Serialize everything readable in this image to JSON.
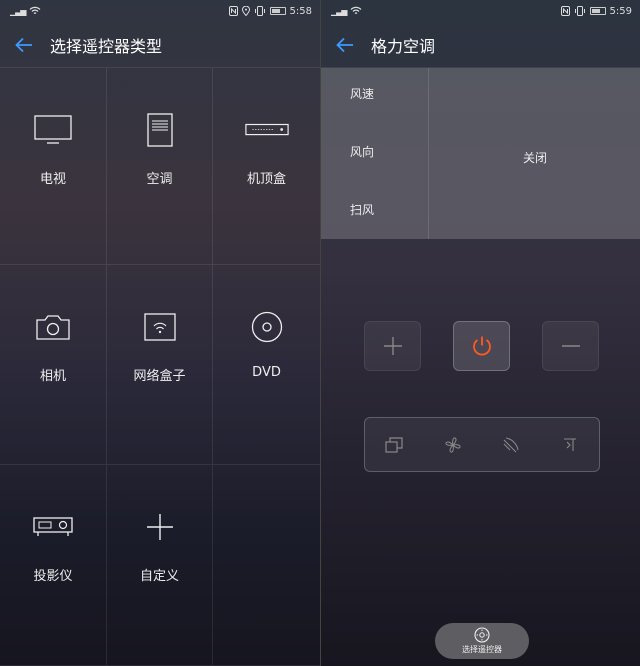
{
  "left": {
    "status": {
      "time": "5:58"
    },
    "title": "选择遥控器类型",
    "devices": [
      {
        "label": "电视",
        "icon": "tv-icon"
      },
      {
        "label": "空调",
        "icon": "air-conditioner-icon"
      },
      {
        "label": "机顶盒",
        "icon": "set-top-box-icon"
      },
      {
        "label": "相机",
        "icon": "camera-icon"
      },
      {
        "label": "网络盒子",
        "icon": "network-box-icon"
      },
      {
        "label": "DVD",
        "icon": "dvd-icon"
      },
      {
        "label": "投影仪",
        "icon": "projector-icon"
      },
      {
        "label": "自定义",
        "icon": "plus-icon"
      }
    ]
  },
  "right": {
    "status": {
      "time": "5:59"
    },
    "title": "格力空调",
    "state_labels": [
      "风速",
      "风向",
      "扫风"
    ],
    "state_value": "关闭",
    "accent": "#ff5a1f",
    "fab_label": "选择遥控器"
  }
}
